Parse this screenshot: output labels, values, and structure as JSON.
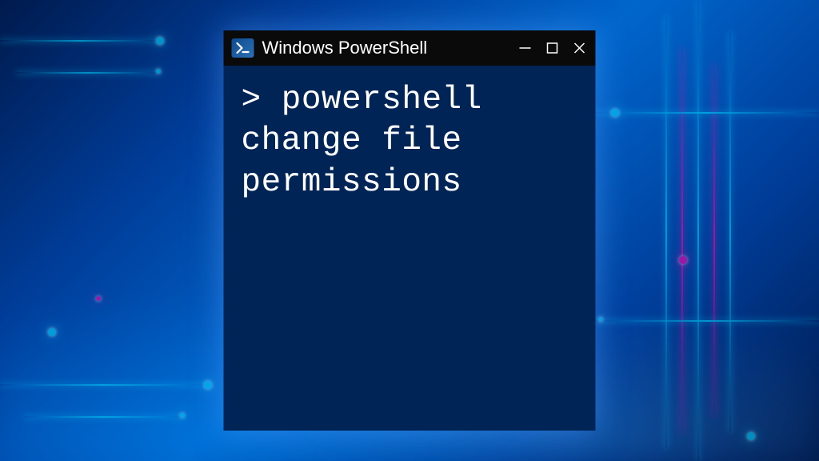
{
  "window": {
    "title": "Windows PowerShell"
  },
  "terminal": {
    "prompt": ">",
    "command": "powershell change file permissions"
  },
  "colors": {
    "terminal_bg": "#012456",
    "titlebar_bg": "#0a0a0a",
    "accent_blue": "#00d4ff",
    "accent_magenta": "#ff00aa"
  }
}
